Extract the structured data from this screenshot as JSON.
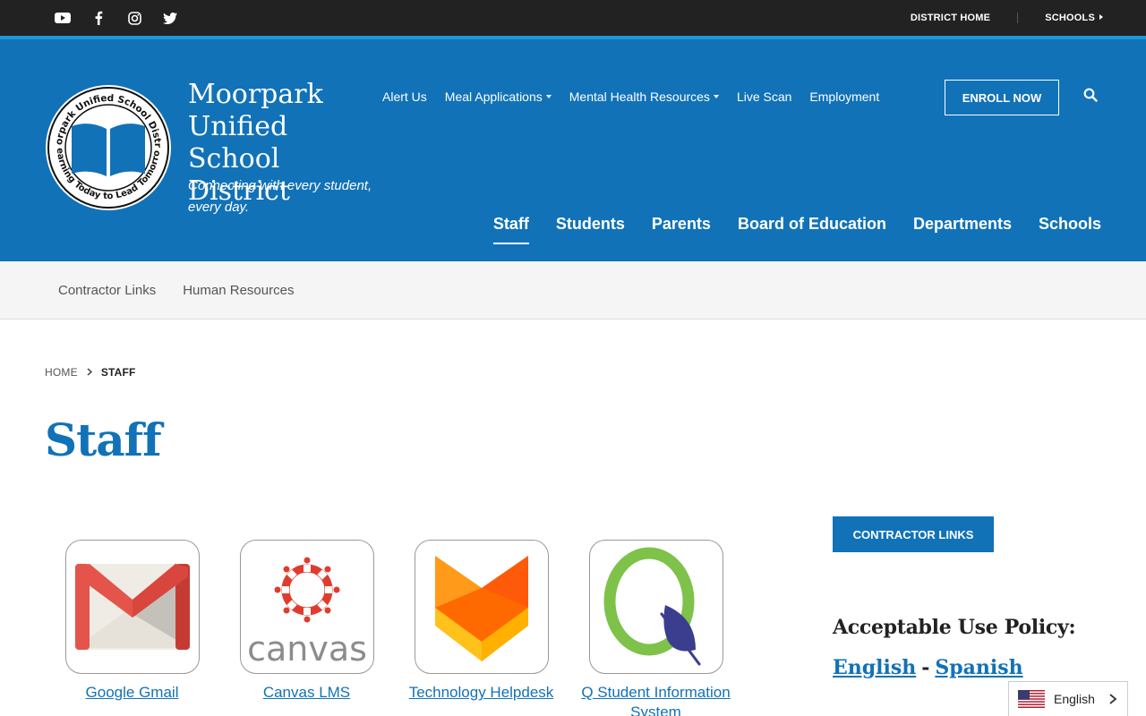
{
  "topbar": {
    "social": [
      {
        "icon": "youtube-icon"
      },
      {
        "icon": "facebook-icon"
      },
      {
        "icon": "instagram-icon"
      },
      {
        "icon": "twitter-icon"
      }
    ],
    "district_home": "DISTRICT HOME",
    "schools": "SCHOOLS"
  },
  "header": {
    "logo_ring_top": "Moorpark Unified School District",
    "logo_ring_bottom": "Learning Today to Lead Tomorrow",
    "title": "Moorpark Unified School District",
    "tagline": "Connecting with every student, every day.",
    "util_nav": [
      {
        "label": "Alert Us",
        "dropdown": false
      },
      {
        "label": "Meal Applications",
        "dropdown": true
      },
      {
        "label": "Mental Health Resources",
        "dropdown": true
      },
      {
        "label": "Live Scan",
        "dropdown": false
      },
      {
        "label": "Employment",
        "dropdown": false
      }
    ],
    "enroll_label": "ENROLL NOW",
    "main_nav": [
      "Staff",
      "Students",
      "Parents",
      "Board of Education",
      "Departments",
      "Schools"
    ]
  },
  "subnav": [
    "Contractor Links",
    "Human Resources"
  ],
  "breadcrumb": {
    "home": "HOME",
    "current": "STAFF"
  },
  "page_title": "Staff",
  "tiles": [
    {
      "label": "Google Gmail",
      "icon": "gmail-icon"
    },
    {
      "label": "Canvas LMS",
      "icon": "canvas-icon",
      "wordmark": "canvas"
    },
    {
      "label": "Technology Helpdesk",
      "icon": "helpdesk-fox-icon"
    },
    {
      "label": "Q Student Information System",
      "icon": "q-sis-icon"
    }
  ],
  "sidebar": {
    "contractor_button": "CONTRACTOR LINKS",
    "aup_title": "Acceptable Use Policy:",
    "aup_english": "English",
    "aup_dash": "-",
    "aup_spanish": "Spanish"
  },
  "language": {
    "label": "English",
    "flag": "us-flag-icon"
  },
  "colors": {
    "brand_blue": "#1172b8",
    "topbar": "#222222",
    "accent_line": "#1a9ad8"
  }
}
